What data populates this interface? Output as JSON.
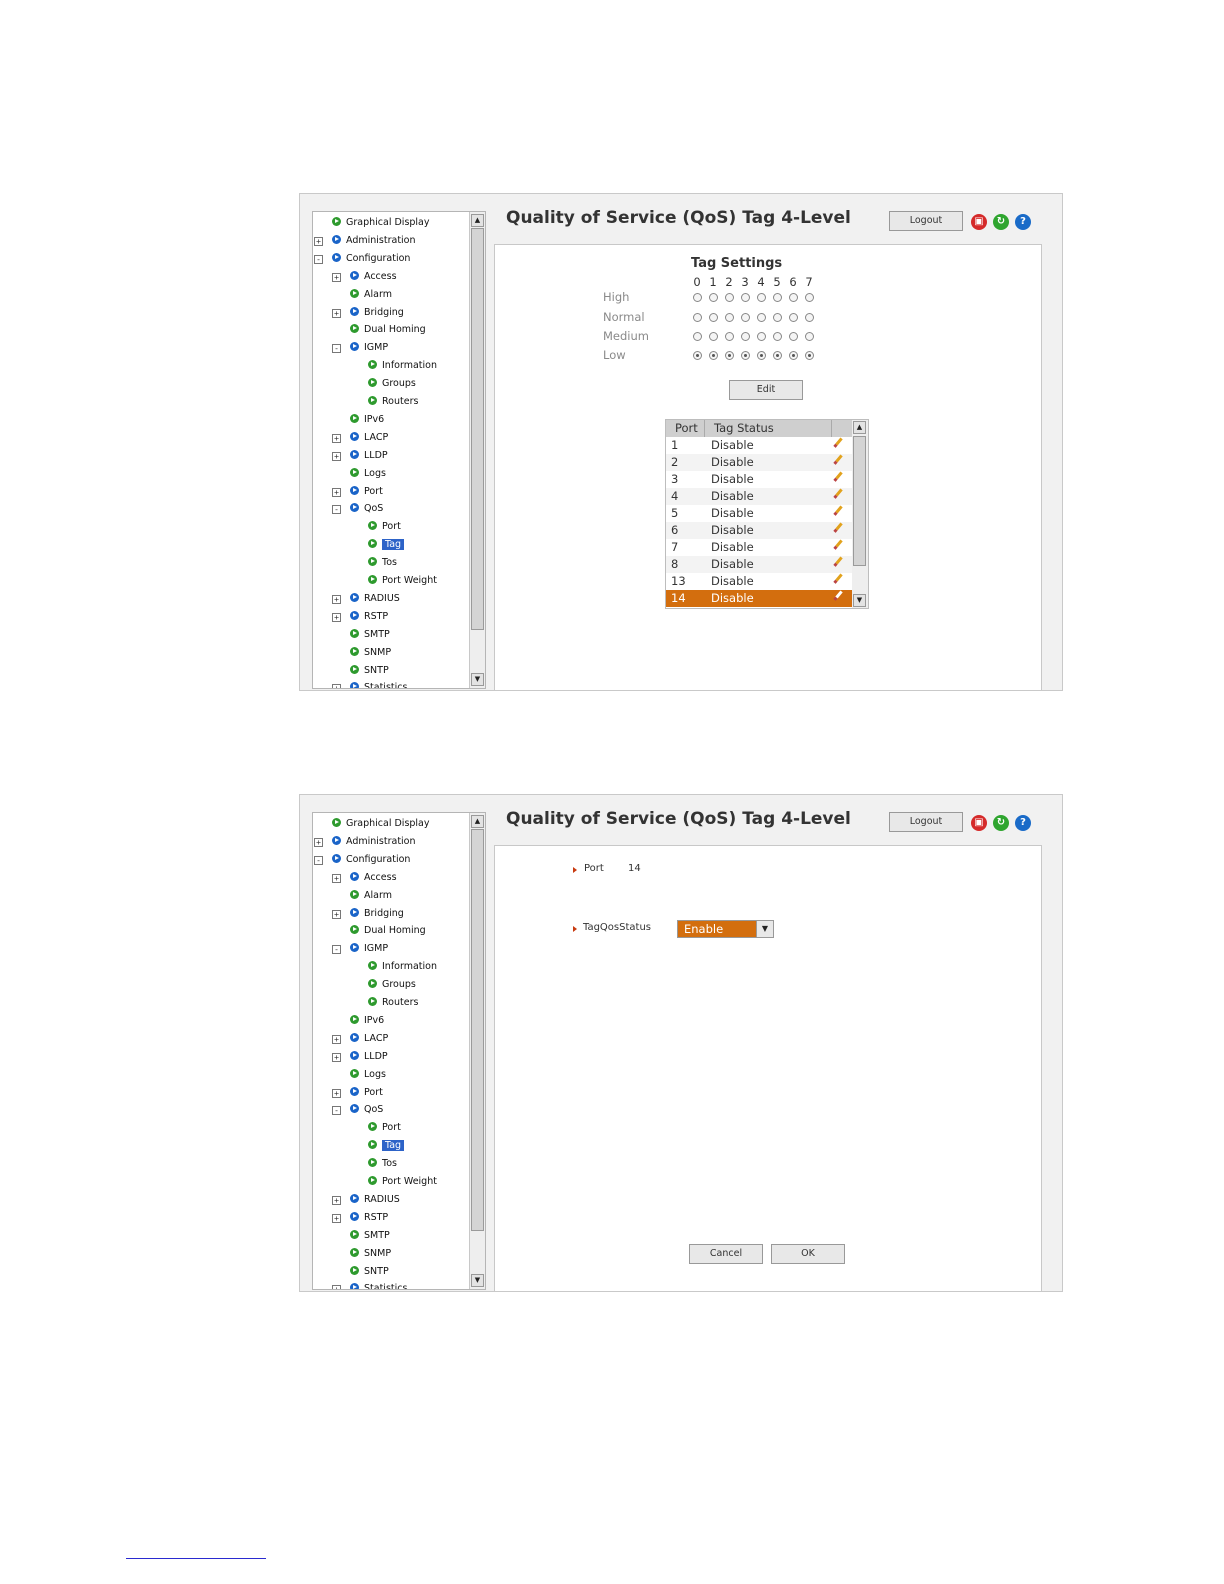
{
  "header": {
    "title": "Quality of Service (QoS) Tag 4-Level",
    "logout_label": "Logout",
    "icons": [
      "save-icon",
      "refresh-icon",
      "help-icon"
    ],
    "icon_colors": {
      "save": "#d52a2a",
      "refresh": "#2fa52f",
      "help": "#1a6bc8"
    }
  },
  "sidebar": {
    "items": [
      {
        "label": "Graphical Display",
        "level": 0,
        "icon": "green",
        "expander": ""
      },
      {
        "label": "Administration",
        "level": 0,
        "icon": "blue",
        "expander": "+"
      },
      {
        "label": "Configuration",
        "level": 0,
        "icon": "blue",
        "expander": "-"
      },
      {
        "label": "Access",
        "level": 1,
        "icon": "blue",
        "expander": "+"
      },
      {
        "label": "Alarm",
        "level": 1,
        "icon": "green",
        "expander": ""
      },
      {
        "label": "Bridging",
        "level": 1,
        "icon": "blue",
        "expander": "+"
      },
      {
        "label": "Dual Homing",
        "level": 1,
        "icon": "green",
        "expander": ""
      },
      {
        "label": "IGMP",
        "level": 1,
        "icon": "blue",
        "expander": "-"
      },
      {
        "label": "Information",
        "level": 2,
        "icon": "green",
        "expander": ""
      },
      {
        "label": "Groups",
        "level": 2,
        "icon": "green",
        "expander": ""
      },
      {
        "label": "Routers",
        "level": 2,
        "icon": "green",
        "expander": ""
      },
      {
        "label": "IPv6",
        "level": 1,
        "icon": "green",
        "expander": ""
      },
      {
        "label": "LACP",
        "level": 1,
        "icon": "blue",
        "expander": "+"
      },
      {
        "label": "LLDP",
        "level": 1,
        "icon": "blue",
        "expander": "+"
      },
      {
        "label": "Logs",
        "level": 1,
        "icon": "green",
        "expander": ""
      },
      {
        "label": "Port",
        "level": 1,
        "icon": "blue",
        "expander": "+"
      },
      {
        "label": "QoS",
        "level": 1,
        "icon": "blue",
        "expander": "-"
      },
      {
        "label": "Port",
        "level": 2,
        "icon": "green",
        "expander": ""
      },
      {
        "label": "Tag",
        "level": 2,
        "icon": "green",
        "expander": "",
        "selected": true
      },
      {
        "label": "Tos",
        "level": 2,
        "icon": "green",
        "expander": ""
      },
      {
        "label": "Port Weight",
        "level": 2,
        "icon": "green",
        "expander": ""
      },
      {
        "label": "RADIUS",
        "level": 1,
        "icon": "blue",
        "expander": "+"
      },
      {
        "label": "RSTP",
        "level": 1,
        "icon": "blue",
        "expander": "+"
      },
      {
        "label": "SMTP",
        "level": 1,
        "icon": "green",
        "expander": ""
      },
      {
        "label": "SNMP",
        "level": 1,
        "icon": "green",
        "expander": ""
      },
      {
        "label": "SNTP",
        "level": 1,
        "icon": "green",
        "expander": ""
      },
      {
        "label": "Statistics",
        "level": 1,
        "icon": "blue",
        "expander": "+"
      }
    ]
  },
  "tag_settings": {
    "title": "Tag Settings",
    "columns": [
      "0",
      "1",
      "2",
      "3",
      "4",
      "5",
      "6",
      "7"
    ],
    "rows": [
      {
        "label": "High",
        "selected": [
          false,
          false,
          false,
          false,
          false,
          false,
          false,
          false
        ]
      },
      {
        "label": "Normal",
        "selected": [
          false,
          false,
          false,
          false,
          false,
          false,
          false,
          false
        ]
      },
      {
        "label": "Medium",
        "selected": [
          false,
          false,
          false,
          false,
          false,
          false,
          false,
          false
        ]
      },
      {
        "label": "Low",
        "selected": [
          true,
          true,
          true,
          true,
          true,
          true,
          true,
          true
        ]
      }
    ],
    "edit_label": "Edit"
  },
  "port_table": {
    "headers": [
      "Port",
      "Tag Status"
    ],
    "rows": [
      {
        "port": "1",
        "status": "Disable"
      },
      {
        "port": "2",
        "status": "Disable"
      },
      {
        "port": "3",
        "status": "Disable"
      },
      {
        "port": "4",
        "status": "Disable"
      },
      {
        "port": "5",
        "status": "Disable"
      },
      {
        "port": "6",
        "status": "Disable"
      },
      {
        "port": "7",
        "status": "Disable"
      },
      {
        "port": "8",
        "status": "Disable"
      },
      {
        "port": "13",
        "status": "Disable"
      },
      {
        "port": "14",
        "status": "Disable",
        "selected": true
      }
    ]
  },
  "edit_form": {
    "port_label": "Port",
    "port_value": "14",
    "status_label": "TagQosStatus",
    "status_value": "Enable",
    "cancel_label": "Cancel",
    "ok_label": "OK"
  },
  "colors": {
    "accent": "#d36e0e",
    "selection": "#2d63c8"
  }
}
